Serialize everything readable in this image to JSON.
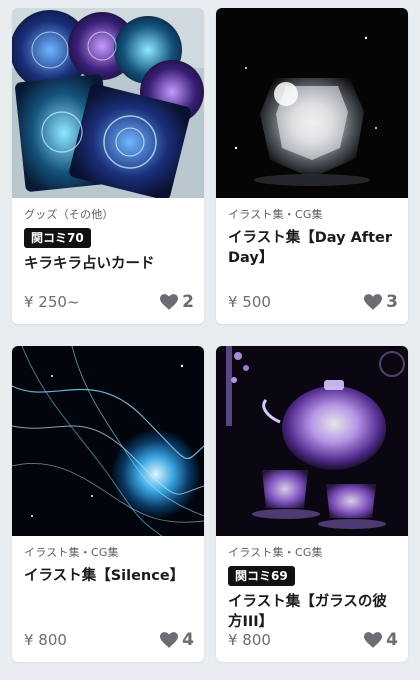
{
  "products": [
    {
      "category": "グッズ（その他）",
      "badge": "関コミ70",
      "title": "キラキラ占いカード",
      "price": "¥ 250~",
      "likes": "2",
      "image": "holographic-tarot-coasters"
    },
    {
      "category": "イラスト集・CG集",
      "badge": "",
      "title": "イラスト集【Day After Day】",
      "price": "¥ 500",
      "likes": "3",
      "image": "crystal-glass-illustration"
    },
    {
      "category": "イラスト集・CG集",
      "badge": "",
      "title": "イラスト集【Silence】",
      "price": "¥ 800",
      "likes": "4",
      "image": "cosmic-blue-planet-illustration"
    },
    {
      "category": "イラスト集・CG集",
      "badge": "関コミ69",
      "title": "イラスト集【ガラスの彼方III】",
      "price": "¥ 800",
      "likes": "4",
      "image": "glass-teapot-lavender-illustration"
    }
  ],
  "colors": {
    "background": "#eaedf0",
    "card": "#ffffff",
    "badge": "#111111",
    "muted_text": "#6a6e73"
  },
  "icons": {
    "like": "heart-icon"
  }
}
